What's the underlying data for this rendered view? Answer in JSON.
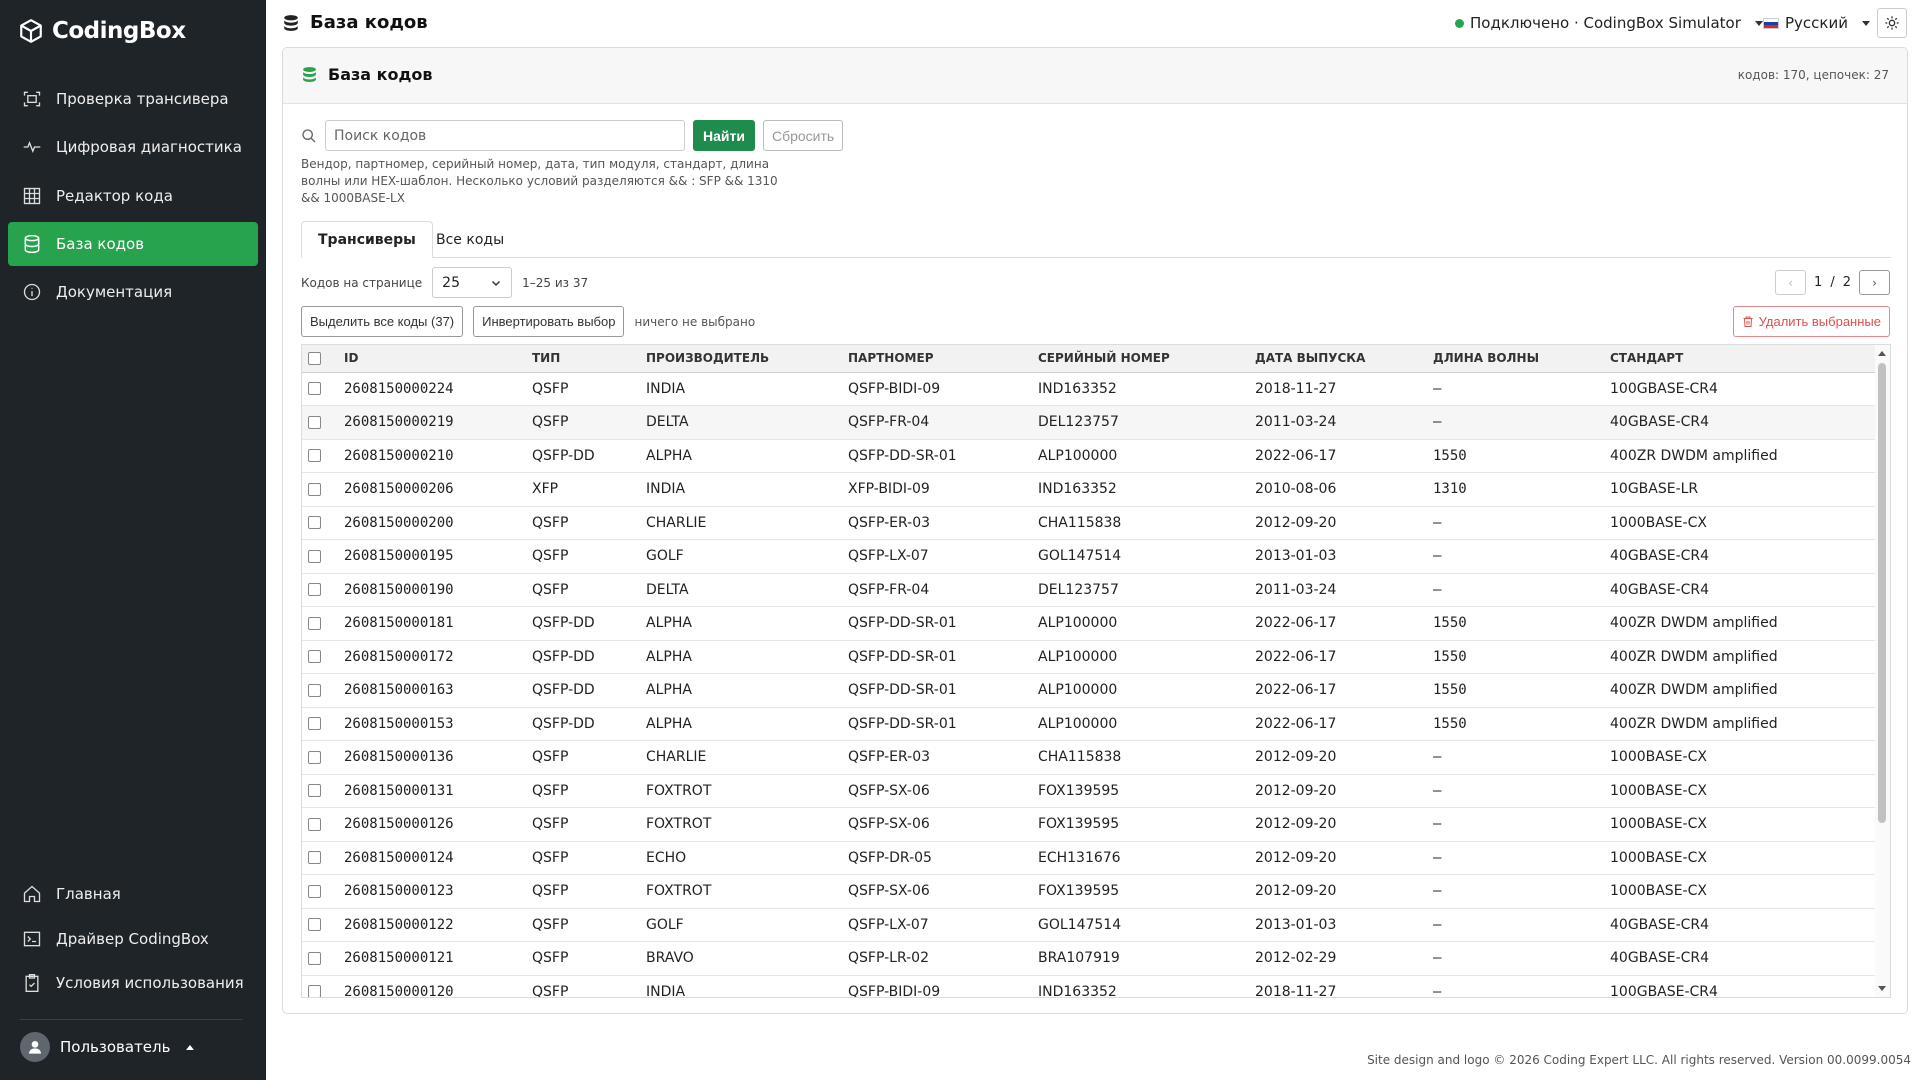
{
  "brand": {
    "name": "CodingBox"
  },
  "sidebar": {
    "items": [
      {
        "label": "Проверка трансивера",
        "icon": "scan-icon"
      },
      {
        "label": "Цифровая диагностика",
        "icon": "pulse-icon"
      },
      {
        "label": "Редактор кода",
        "icon": "grid-icon"
      },
      {
        "label": "База кодов",
        "icon": "database-icon",
        "active": true
      },
      {
        "label": "Документация",
        "icon": "info-icon"
      }
    ],
    "bottom_items": [
      {
        "label": "Главная",
        "icon": "home-icon"
      },
      {
        "label": "Драйвер CodingBox",
        "icon": "terminal-icon"
      },
      {
        "label": "Условия использования",
        "icon": "clipboard-check-icon"
      }
    ],
    "user": {
      "label": "Пользователь"
    }
  },
  "header": {
    "title": "База кодов",
    "status": "Подключено · CodingBox Simulator",
    "language": "Русский"
  },
  "card": {
    "title": "База кодов",
    "count": "кодов: 170, цепочек: 27"
  },
  "search": {
    "placeholder": "Поиск кодов",
    "value": "",
    "find_label": "Найти",
    "reset_label": "Сбросить",
    "hint": "Вендор, партномер, серийный номер, дата, тип модуля, стандарт, длина волны или HEX-шаблон. Несколько условий разделяются && : SFP && 1310 && 1000BASE-LX"
  },
  "tabs": [
    {
      "label": "Трансиверы",
      "active": true
    },
    {
      "label": "Все коды",
      "active": false
    }
  ],
  "pagination": {
    "per_page_label": "Кодов на странице",
    "per_page": "25",
    "range": "1–25 из 37",
    "prev": "‹",
    "next": "›",
    "current": "1",
    "separator": "/",
    "total": "2"
  },
  "selection": {
    "select_all_label": "Выделить все коды (37)",
    "invert_label": "Инвертировать выбор",
    "status": "ничего не выбрано",
    "delete_label": "Удалить выбранные"
  },
  "table": {
    "columns": [
      "ID",
      "ТИП",
      "ПРОИЗВОДИТЕЛЬ",
      "ПАРТНОМЕР",
      "СЕРИЙНЫЙ НОМЕР",
      "ДАТА ВЫПУСКА",
      "ДЛИНА ВОЛНЫ",
      "СТАНДАРТ"
    ],
    "rows": [
      [
        "2608150000224",
        "QSFP",
        "INDIA",
        "QSFP-BIDI-09",
        "IND163352",
        "2018-11-27",
        "–",
        "100GBASE-CR4"
      ],
      [
        "2608150000219",
        "QSFP",
        "DELTA",
        "QSFP-FR-04",
        "DEL123757",
        "2011-03-24",
        "–",
        "40GBASE-CR4"
      ],
      [
        "2608150000210",
        "QSFP-DD",
        "ALPHA",
        "QSFP-DD-SR-01",
        "ALP100000",
        "2022-06-17",
        "1550",
        "400ZR DWDM amplified"
      ],
      [
        "2608150000206",
        "XFP",
        "INDIA",
        "XFP-BIDI-09",
        "IND163352",
        "2010-08-06",
        "1310",
        "10GBASE-LR"
      ],
      [
        "2608150000200",
        "QSFP",
        "CHARLIE",
        "QSFP-ER-03",
        "CHA115838",
        "2012-09-20",
        "–",
        "1000BASE-CX"
      ],
      [
        "2608150000195",
        "QSFP",
        "GOLF",
        "QSFP-LX-07",
        "GOL147514",
        "2013-01-03",
        "–",
        "40GBASE-CR4"
      ],
      [
        "2608150000190",
        "QSFP",
        "DELTA",
        "QSFP-FR-04",
        "DEL123757",
        "2011-03-24",
        "–",
        "40GBASE-CR4"
      ],
      [
        "2608150000181",
        "QSFP-DD",
        "ALPHA",
        "QSFP-DD-SR-01",
        "ALP100000",
        "2022-06-17",
        "1550",
        "400ZR DWDM amplified"
      ],
      [
        "2608150000172",
        "QSFP-DD",
        "ALPHA",
        "QSFP-DD-SR-01",
        "ALP100000",
        "2022-06-17",
        "1550",
        "400ZR DWDM amplified"
      ],
      [
        "2608150000163",
        "QSFP-DD",
        "ALPHA",
        "QSFP-DD-SR-01",
        "ALP100000",
        "2022-06-17",
        "1550",
        "400ZR DWDM amplified"
      ],
      [
        "2608150000153",
        "QSFP-DD",
        "ALPHA",
        "QSFP-DD-SR-01",
        "ALP100000",
        "2022-06-17",
        "1550",
        "400ZR DWDM amplified"
      ],
      [
        "2608150000136",
        "QSFP",
        "CHARLIE",
        "QSFP-ER-03",
        "CHA115838",
        "2012-09-20",
        "–",
        "1000BASE-CX"
      ],
      [
        "2608150000131",
        "QSFP",
        "FOXTROT",
        "QSFP-SX-06",
        "FOX139595",
        "2012-09-20",
        "–",
        "1000BASE-CX"
      ],
      [
        "2608150000126",
        "QSFP",
        "FOXTROT",
        "QSFP-SX-06",
        "FOX139595",
        "2012-09-20",
        "–",
        "1000BASE-CX"
      ],
      [
        "2608150000124",
        "QSFP",
        "ECHO",
        "QSFP-DR-05",
        "ECH131676",
        "2012-09-20",
        "–",
        "1000BASE-CX"
      ],
      [
        "2608150000123",
        "QSFP",
        "FOXTROT",
        "QSFP-SX-06",
        "FOX139595",
        "2012-09-20",
        "–",
        "1000BASE-CX"
      ],
      [
        "2608150000122",
        "QSFP",
        "GOLF",
        "QSFP-LX-07",
        "GOL147514",
        "2013-01-03",
        "–",
        "40GBASE-CR4"
      ],
      [
        "2608150000121",
        "QSFP",
        "BRAVO",
        "QSFP-LR-02",
        "BRA107919",
        "2012-02-29",
        "–",
        "40GBASE-CR4"
      ],
      [
        "2608150000120",
        "QSFP",
        "INDIA",
        "QSFP-BIDI-09",
        "IND163352",
        "2018-11-27",
        "–",
        "100GBASE-CR4"
      ]
    ]
  },
  "footer": "Site design and logo © 2026 Coding Expert LLC. All rights reserved. Version 00.0099.0054",
  "colors": {
    "sidebar_bg": "#1f2429",
    "accent": "#27a24d",
    "status_connected": "#21a84f",
    "danger": "#d9534f"
  }
}
